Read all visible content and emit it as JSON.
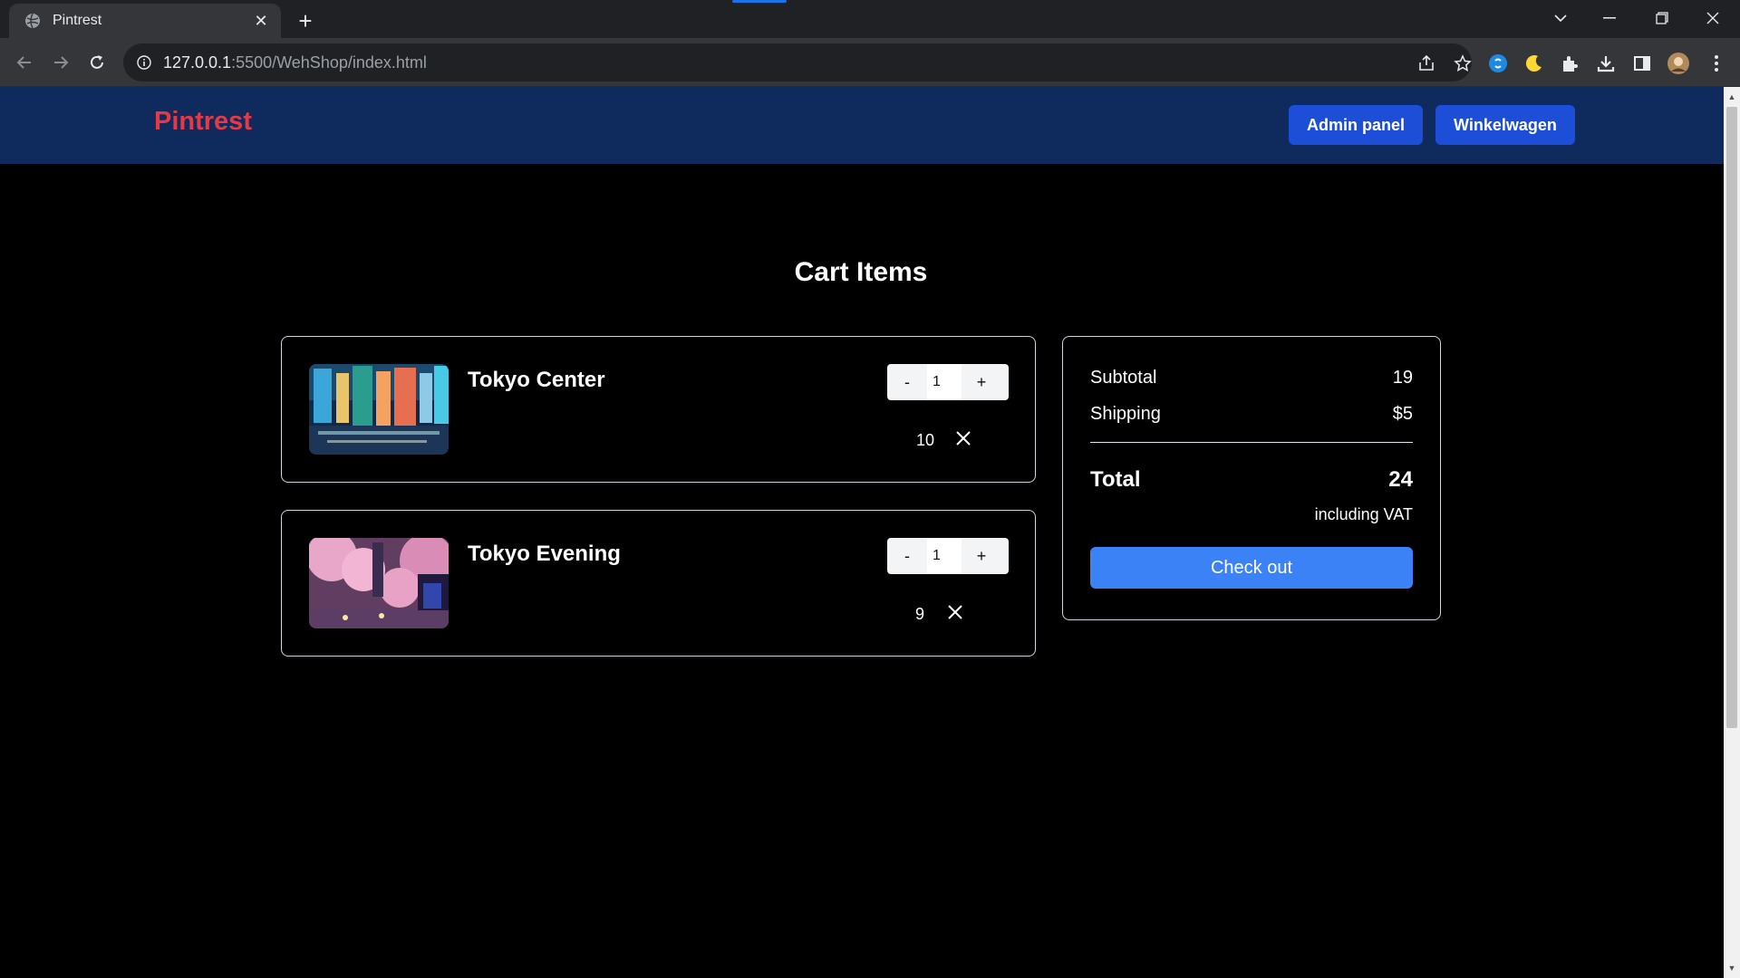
{
  "browser": {
    "tab_title": "Pintrest",
    "url_host": "127.0.0.1",
    "url_rest": ":5500/WehShop/index.html"
  },
  "header": {
    "brand": "Pintrest",
    "admin_button": "Admin panel",
    "cart_button": "Winkelwagen"
  },
  "cart": {
    "title": "Cart Items",
    "items": [
      {
        "name": "Tokyo Center",
        "qty_minus": "-",
        "quantity": "1",
        "qty_plus": "+",
        "price": "10"
      },
      {
        "name": "Tokyo Evening",
        "qty_minus": "-",
        "quantity": "1",
        "qty_plus": "+",
        "price": "9"
      }
    ]
  },
  "summary": {
    "subtotal_label": "Subtotal",
    "subtotal_value": "19",
    "shipping_label": "Shipping",
    "shipping_value": "$5",
    "total_label": "Total",
    "total_value": "24",
    "vat_note": "including VAT",
    "checkout_label": "Check out"
  },
  "colors": {
    "header_bg": "#0f2a5c",
    "brand": "#e63946",
    "header_button": "#1d4ed8",
    "checkout_button": "#3b82f6"
  }
}
